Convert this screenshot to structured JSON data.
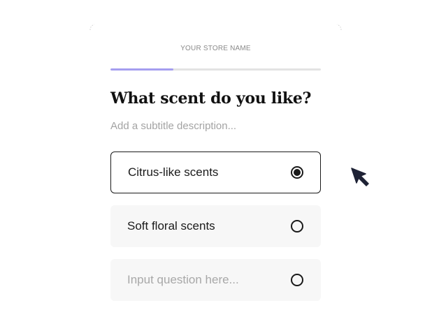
{
  "header": {
    "store_name": "YOUR STORE NAME"
  },
  "progress": {
    "fraction": 0.3,
    "fill_color": "#a59ef0",
    "track_color": "#e3e3e3"
  },
  "question": {
    "title": "What scent do you like?",
    "subtitle_placeholder": "Add a subtitle description..."
  },
  "options": [
    {
      "label": "Citrus-like scents",
      "selected": true,
      "is_placeholder": false
    },
    {
      "label": "Soft floral scents",
      "selected": false,
      "is_placeholder": false
    },
    {
      "label": "Input question here...",
      "selected": false,
      "is_placeholder": true
    }
  ],
  "icons": {
    "cursor": "pointer-cursor-icon",
    "radio_selected": "radio-selected-icon",
    "radio_empty": "radio-empty-icon"
  },
  "colors": {
    "text_primary": "#1a1a1a",
    "text_muted": "#a3a3a3",
    "option_bg": "#f7f7f7",
    "accent": "#a59ef0",
    "cursor": "#1e2235"
  }
}
